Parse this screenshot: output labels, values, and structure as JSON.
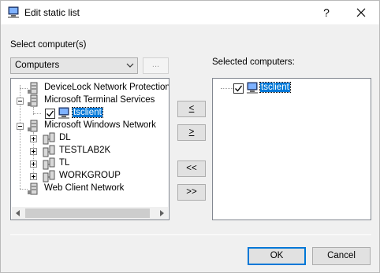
{
  "window": {
    "title": "Edit static list",
    "help_label": "?",
    "close_icon": "close-icon",
    "app_icon": "computer-icon"
  },
  "left": {
    "label": "Select computer(s)",
    "combo_value": "Computers",
    "browse_label": "...",
    "tree": [
      {
        "label": "DeviceLock Network Protection",
        "icon": "server-icon",
        "expander": "none",
        "level": 0
      },
      {
        "label": "Microsoft Terminal Services",
        "icon": "server-icon",
        "expander": "minus",
        "level": 0
      },
      {
        "label": "tsclient",
        "icon": "computer-icon",
        "checked": true,
        "selected": true,
        "level": 1
      },
      {
        "label": "Microsoft Windows Network",
        "icon": "server-icon",
        "expander": "minus",
        "level": 0
      },
      {
        "label": "DL",
        "icon": "network-icon",
        "expander": "plus",
        "level": 1
      },
      {
        "label": "TESTLAB2K",
        "icon": "network-icon",
        "expander": "plus",
        "level": 1
      },
      {
        "label": "TL",
        "icon": "network-icon",
        "expander": "plus",
        "level": 1
      },
      {
        "label": "WORKGROUP",
        "icon": "network-icon",
        "expander": "plus",
        "level": 1
      },
      {
        "label": "Web Client Network",
        "icon": "server-icon",
        "expander": "none",
        "level": 0
      }
    ]
  },
  "middle_buttons": {
    "remove": "<",
    "add": ">",
    "remove_all": "<<",
    "add_all": ">>"
  },
  "right": {
    "label": "Selected computers:",
    "tree": [
      {
        "label": "tsclient",
        "icon": "computer-icon",
        "checked": true,
        "selected": true
      }
    ]
  },
  "footer": {
    "ok_label": "OK",
    "cancel_label": "Cancel"
  },
  "colors": {
    "selection": "#0078d7",
    "dialog_bg": "#f0f0f0",
    "border": "#828790"
  }
}
